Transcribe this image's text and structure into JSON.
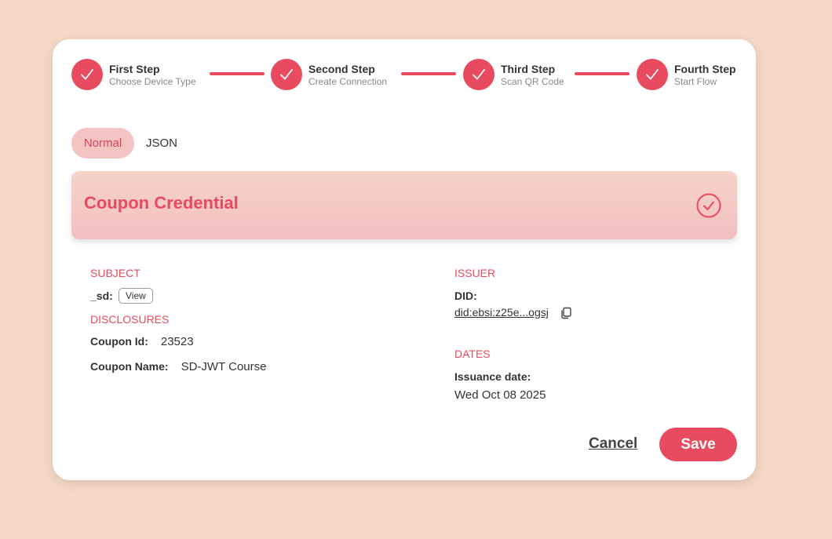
{
  "steps": [
    {
      "title": "First Step",
      "subtitle": "Choose Device Type"
    },
    {
      "title": "Second Step",
      "subtitle": "Create Connection"
    },
    {
      "title": "Third Step",
      "subtitle": "Scan QR Code"
    },
    {
      "title": "Fourth Step",
      "subtitle": "Start Flow"
    }
  ],
  "tabs": {
    "normal": "Normal",
    "json": "JSON",
    "active": "Normal"
  },
  "credential": {
    "title": "Coupon Credential"
  },
  "subject": {
    "heading": "SUBJECT",
    "sd_label": "_sd:",
    "view_label": "View"
  },
  "disclosures": {
    "heading": "DISCLOSURES",
    "items": [
      {
        "label": "Coupon Id:",
        "value": "23523"
      },
      {
        "label": "Coupon Name:",
        "value": "SD-JWT Course"
      }
    ]
  },
  "issuer": {
    "heading": "ISSUER",
    "did_label": "DID:",
    "did_value": "did:ebsi:z25e...ogsj"
  },
  "dates": {
    "heading": "DATES",
    "issuance_label": "Issuance date:",
    "issuance_value": "Wed Oct 08 2025"
  },
  "actions": {
    "cancel": "Cancel",
    "save": "Save"
  },
  "colors": {
    "accent": "#e84a5f",
    "background": "#f5d9c7",
    "tab_active_bg": "#f4c4c2"
  },
  "icons": {
    "step": "check-icon",
    "banner": "check-circle-icon",
    "copy": "copy-icon"
  }
}
